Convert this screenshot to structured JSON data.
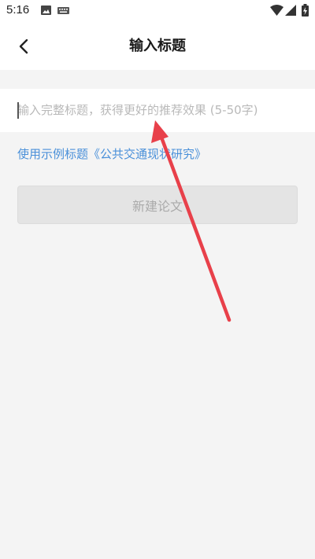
{
  "status_bar": {
    "time": "5:16",
    "icons": [
      "image-icon",
      "keyboard-icon",
      "wifi-icon",
      "signal-icon",
      "battery-charging-icon"
    ]
  },
  "app_bar": {
    "title": "输入标题",
    "back_icon": "chevron-left-icon"
  },
  "title_input": {
    "value": "",
    "placeholder": "输入完整标题，获得更好的推荐效果 (5-50字)"
  },
  "example_link": {
    "label": "使用示例标题《公共交通现状研究》"
  },
  "create_button": {
    "label": "新建论文",
    "enabled": false
  },
  "annotation": {
    "arrow_color": "#e8404a"
  },
  "colors": {
    "link": "#4a90d9",
    "background": "#f4f4f4",
    "button_disabled": "#e4e4e4"
  }
}
